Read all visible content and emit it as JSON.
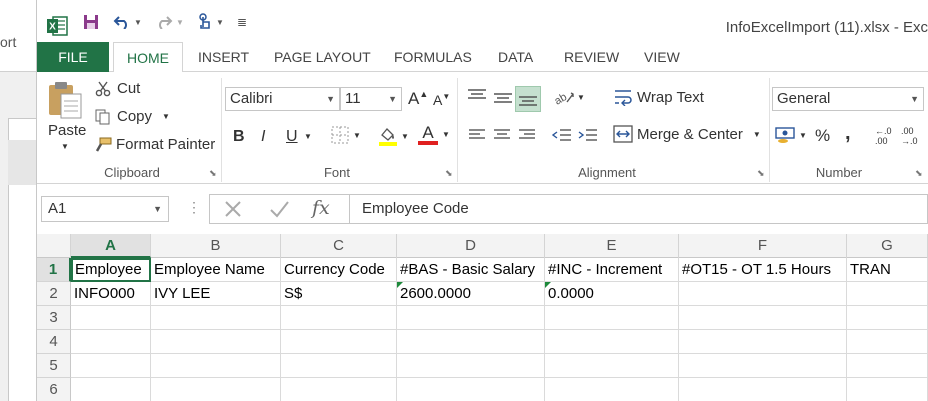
{
  "background_window": {
    "partial_text": "ort"
  },
  "window": {
    "title": "InfoExcelImport (11).xlsx - Exc"
  },
  "quick_access": {
    "customize_glyph": "≣"
  },
  "ribbon_tabs": [
    {
      "label": "FILE"
    },
    {
      "label": "HOME"
    },
    {
      "label": "INSERT"
    },
    {
      "label": "PAGE LAYOUT"
    },
    {
      "label": "FORMULAS"
    },
    {
      "label": "DATA"
    },
    {
      "label": "REVIEW"
    },
    {
      "label": "VIEW"
    }
  ],
  "clipboard": {
    "paste": "Paste",
    "cut": "Cut",
    "copy": "Copy",
    "format_painter": "Format Painter",
    "group_label": "Clipboard"
  },
  "font": {
    "family": "Calibri",
    "size": "11",
    "bold": "B",
    "italic": "I",
    "underline": "U",
    "grow": "A",
    "shrink": "A",
    "color_glyph": "A",
    "group_label": "Font"
  },
  "alignment": {
    "wrap_text": "Wrap Text",
    "merge_center": "Merge & Center",
    "group_label": "Alignment"
  },
  "number": {
    "format": "General",
    "percent": "%",
    "comma": ",",
    "inc_decimal_top": "←.0",
    "inc_decimal_bottom": ".00",
    "dec_decimal_top": ".00",
    "dec_decimal_bottom": "→.0",
    "group_label": "Number"
  },
  "formula_bar": {
    "name_box": "A1",
    "fx": "fx",
    "content": "Employee Code"
  },
  "sheet": {
    "columns": [
      "A",
      "B",
      "C",
      "D",
      "E",
      "F",
      "G"
    ],
    "rows": [
      "1",
      "2",
      "3",
      "4",
      "5",
      "6"
    ],
    "cells": {
      "A1": "Employee",
      "B1": "Employee Name",
      "C1": "Currency Code",
      "D1": "#BAS - Basic Salary",
      "E1": "#INC - Increment",
      "F1": "#OT15 - OT 1.5 Hours",
      "G1": "TRAN",
      "A2": "INFO000",
      "B2": "IVY LEE",
      "C2": "S$",
      "D2": "2600.0000",
      "E2": "0.0000"
    }
  },
  "colors": {
    "excel_green": "#217346",
    "error_flag": "#1e8a3c",
    "highlight_yellow": "#ffff00",
    "font_red": "#e02020"
  }
}
